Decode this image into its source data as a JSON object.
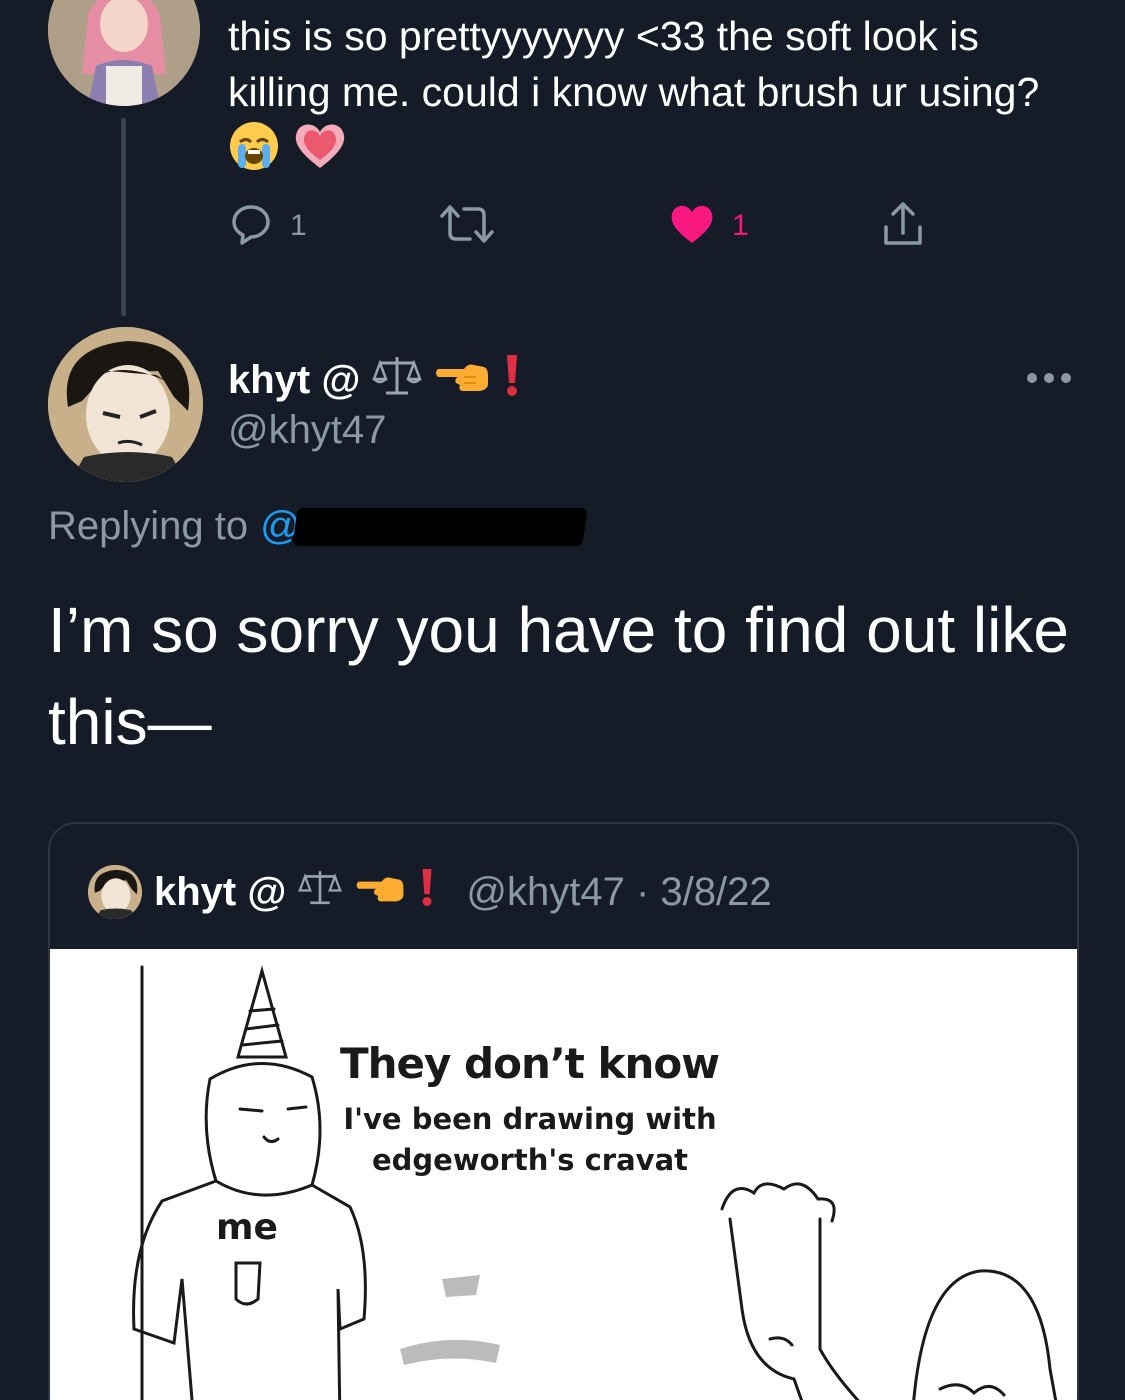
{
  "previous_tweet": {
    "text": "this is so prettyyyyyyy <33 the soft look is killing me. could i know what brush ur using?",
    "emoji_1": "loudly-crying-face",
    "emoji_2": "growing-heart",
    "reply_count": "1",
    "like_count": "1",
    "like_color": "#f91880"
  },
  "main_tweet": {
    "display_name": "khyt @",
    "name_emojis": [
      "balance-scale",
      "backhand-index-pointing-left",
      "exclamation-mark"
    ],
    "handle": "@khyt47",
    "replying_to_label": "Replying to",
    "replying_to_handle_start": "@",
    "text": "I’m so sorry you have to find out like this—"
  },
  "quote_tweet": {
    "display_name": "khyt @",
    "handle": "@khyt47",
    "separator": "·",
    "date": "3/8/22",
    "image": {
      "title": "They don’t know",
      "subtitle": "I've been drawing with edgeworth's cravat",
      "label_me": "me"
    }
  },
  "colors": {
    "background": "#151c27",
    "secondary_text": "#8b98a5",
    "link": "#1d9bf0"
  }
}
